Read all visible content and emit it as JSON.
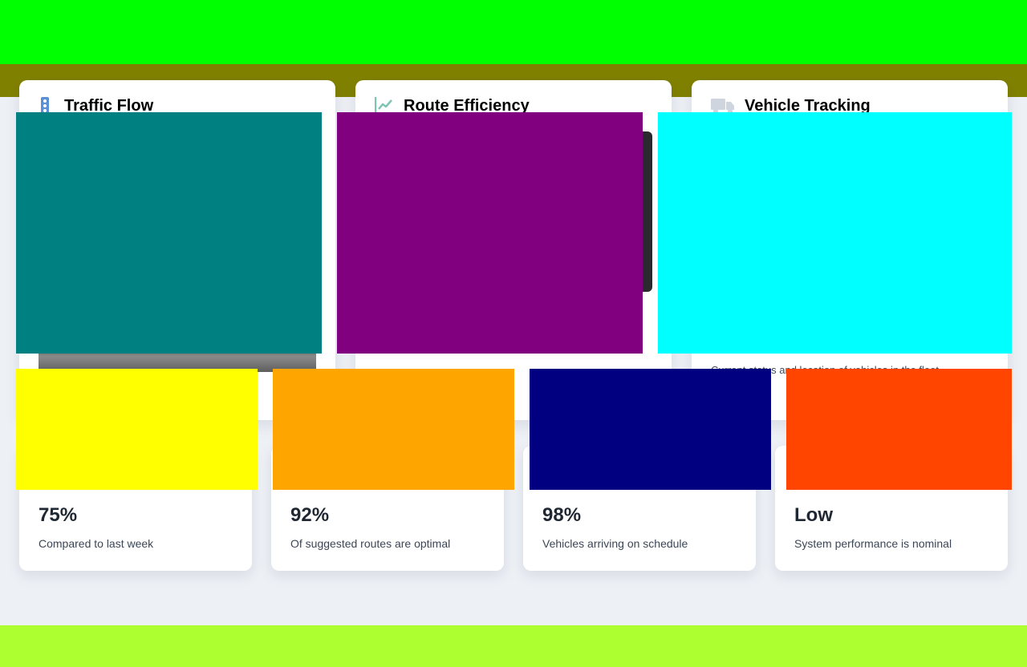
{
  "feature_cards": [
    {
      "title": "Traffic Flow",
      "icon": "traffic-light-icon",
      "icon_color": "#5b8fd6"
    },
    {
      "title": "Route Efficiency",
      "icon": "line-chart-icon",
      "icon_color": "#7cc4b4"
    },
    {
      "title": "Vehicle Tracking",
      "icon": "truck-icon",
      "icon_color": "#cfd5de",
      "description": "Current status and location of vehicles in the fleet"
    }
  ],
  "stats": [
    {
      "value": "75%",
      "caption": "Compared to last week"
    },
    {
      "value": "92%",
      "caption": "Of suggested routes are optimal"
    },
    {
      "value": "98%",
      "caption": "Vehicles arriving on schedule"
    },
    {
      "value": "Low",
      "caption": "System performance is nominal"
    }
  ],
  "colors": {
    "top_bar": "#00ff00",
    "sub_bar": "#808000",
    "bottom_bar": "#adff2f",
    "overlay_teal": "#008080",
    "overlay_purple": "#800080",
    "overlay_cyan": "#00ffff",
    "overlay_yellow": "#ffff00",
    "overlay_orange": "#ffa500",
    "overlay_navy": "#000080",
    "overlay_red": "#ff4500"
  }
}
